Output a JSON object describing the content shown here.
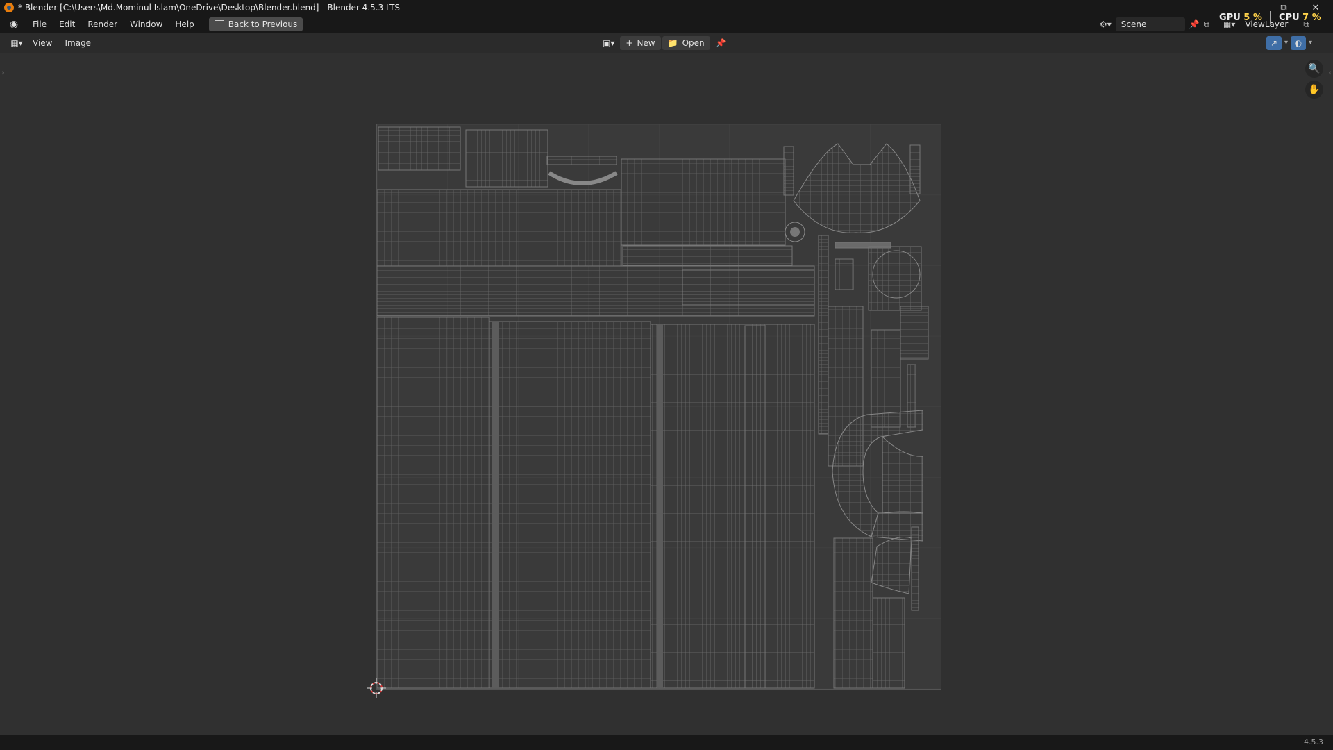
{
  "window": {
    "title": "* Blender [C:\\Users\\Md.Mominul Islam\\OneDrive\\Desktop\\Blender.blend] - Blender 4.5.3 LTS",
    "minimize_icon": "minimize-icon",
    "restore_icon": "restore-icon",
    "close_icon": "close-icon"
  },
  "menubar": {
    "items": [
      "File",
      "Edit",
      "Render",
      "Window",
      "Help"
    ],
    "back_button": "Back to Previous",
    "scene_label": "Scene",
    "viewlayer_label": "ViewLayer"
  },
  "stats": {
    "gpu_label": "GPU",
    "gpu_value": "5 %",
    "cpu_label": "CPU",
    "cpu_value": "7 %"
  },
  "editor_header": {
    "menus": [
      "View",
      "Image"
    ],
    "new_button": "New",
    "open_button": "Open"
  },
  "statusbar": {
    "version": "4.5.3"
  },
  "colors": {
    "accent": "#3f6ea6",
    "stat_value": "#ffd24a",
    "blender_orange": "#e87d0d"
  }
}
